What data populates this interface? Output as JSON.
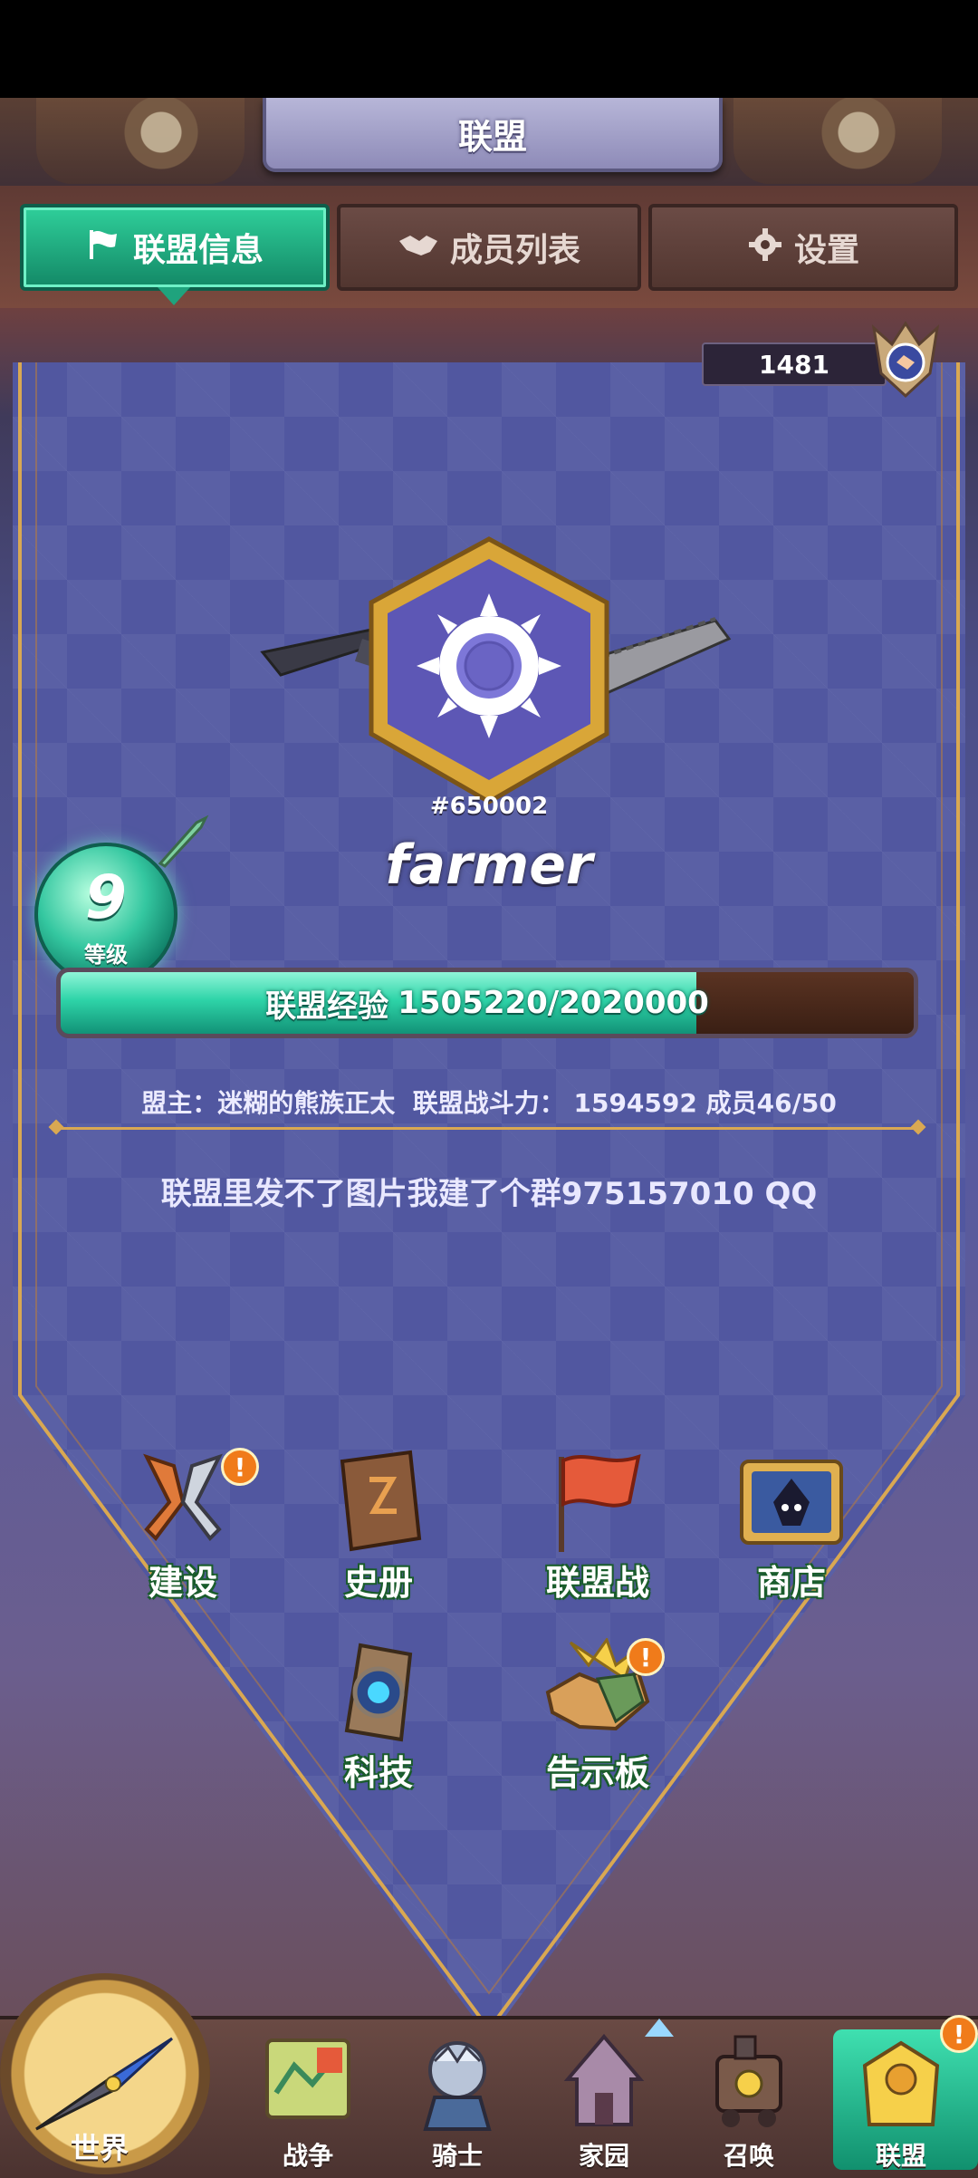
{
  "header": {
    "title": "联盟"
  },
  "tabs": [
    {
      "label": "联盟信息",
      "icon": "flag-icon",
      "active": true
    },
    {
      "label": "成员列表",
      "icon": "handshake-icon",
      "active": false
    },
    {
      "label": "设置",
      "icon": "gear-icon",
      "active": false
    }
  ],
  "score": "1481",
  "guild": {
    "id": "#650002",
    "name": "farmer",
    "level": "9",
    "level_label": "等级",
    "exp_label": "联盟经验",
    "exp_value": "1505220/2020000",
    "exp_fraction": 0.745,
    "leader_label": "盟主：",
    "leader_name": "迷糊的熊族正太",
    "power_label": "联盟战斗力：",
    "power_value": "1594592",
    "members_label": "成员",
    "members_value": "46/50",
    "notice": "联盟里发不了图片我建了个群975157010 QQ"
  },
  "functions": [
    {
      "label": "建设",
      "icon": "saw-hammer-icon",
      "badge": "!"
    },
    {
      "label": "史册",
      "icon": "book-icon",
      "badge": ""
    },
    {
      "label": "联盟战",
      "icon": "red-flag-icon",
      "badge": ""
    },
    {
      "label": "商店",
      "icon": "shop-icon",
      "badge": ""
    },
    {
      "label": "科技",
      "icon": "tech-icon",
      "badge": ""
    },
    {
      "label": "告示板",
      "icon": "handshake-board-icon",
      "badge": "!"
    }
  ],
  "nav": {
    "world": "世界",
    "items": [
      {
        "label": "战争",
        "icon": "map-icon"
      },
      {
        "label": "骑士",
        "icon": "knight-icon"
      },
      {
        "label": "家园",
        "icon": "house-icon"
      },
      {
        "label": "召唤",
        "icon": "train-icon"
      },
      {
        "label": "联盟",
        "icon": "alliance-icon",
        "badge": "!"
      }
    ]
  },
  "colors": {
    "accent": "#2ed4a8",
    "gold": "#d9a852",
    "badge": "#f07b1a"
  }
}
